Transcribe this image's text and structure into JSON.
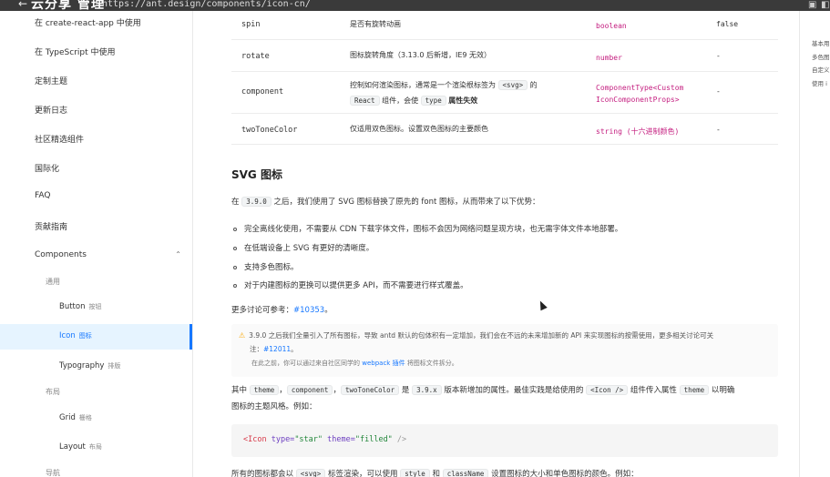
{
  "browser": {
    "back_glyph": "←",
    "brand": "云分享 管理",
    "url": "https://ant.design/components/icon-cn/",
    "ext_icon_1": "▣",
    "ext_icon_2": "◧"
  },
  "sidebar": {
    "items": [
      {
        "label": "在 create-react-app 中使用"
      },
      {
        "label": "在 TypeScript 中使用"
      },
      {
        "label": "定制主题"
      },
      {
        "label": "更新日志"
      },
      {
        "label": "社区精选组件"
      },
      {
        "label": "国际化"
      },
      {
        "label": "FAQ"
      },
      {
        "label": "贡献指南"
      },
      {
        "label": "Components",
        "caret": "⌃"
      },
      {
        "label": "通用"
      },
      {
        "label": "Button",
        "cn": "按钮"
      },
      {
        "label": "Icon",
        "cn": "图标"
      },
      {
        "label": "Typography",
        "cn": "排版"
      },
      {
        "label": "布局"
      },
      {
        "label": "Grid",
        "cn": "栅格"
      },
      {
        "label": "Layout",
        "cn": "布局"
      },
      {
        "label": "导航"
      }
    ]
  },
  "table": {
    "rows": [
      {
        "prop": "spin",
        "desc": "是否有旋转动画",
        "type": "boolean",
        "default": "false"
      },
      {
        "prop": "rotate",
        "desc": "图标旋转角度（3.13.0 后新增，IE9 无效）",
        "type": "number",
        "default": "-"
      },
      {
        "prop": "component",
        "desc_a": "控制如何渲染图标，通常是一个渲染根标签为",
        "desc_code1": "<svg>",
        "desc_b": "的",
        "desc_code2": "React",
        "desc_c": "组件，会使",
        "desc_code3": "type",
        "desc_d": "属性失效",
        "type_line1": "ComponentType<Custom",
        "type_line2": "IconComponentProps>",
        "default": "-"
      },
      {
        "prop": "twoToneColor",
        "desc": "仅适用双色图标。设置双色图标的主要颜色",
        "type": "string (十六进制颜色)",
        "default": "-"
      }
    ]
  },
  "section": {
    "title": "SVG 图标",
    "intro_a": "在",
    "intro_code": "3.9.0",
    "intro_b": "之后，我们使用了 SVG 图标替换了原先的 font 图标，从而带来了以下优势：",
    "bullets": [
      "完全离线化使用，不需要从 CDN 下载字体文件，图标不会因为网络问题呈现方块，也无需字体文件本地部署。",
      "在低端设备上 SVG 有更好的清晰度。",
      "支持多色图标。",
      "对于内建图标的更换可以提供更多 API，而不需要进行样式覆盖。"
    ],
    "more_a": "更多讨论可参考：",
    "more_link": "#10353",
    "more_b": "。",
    "warning": {
      "icon": "⚠",
      "line1": "3.9.0 之后我们全量引入了所有图标，导致 antd 默认的包体积有一定增加，我们会在不远的未来增加新的 API 来实现图标的按需使用，更多相关讨论可关",
      "line2_a": "注：",
      "line2_link": "#12011",
      "line2_b": "。",
      "line3_a": "在此之前，你可以通过来自社区同学的",
      "line3_link": "webpack 插件",
      "line3_b": "将图标文件拆分。"
    },
    "props_para": {
      "a": "其中",
      "c1": "theme",
      "sep1": "，",
      "c2": "component",
      "sep2": "，",
      "c3": "twoToneColor",
      "b": "是",
      "c4": "3.9.x",
      "c": "版本新增加的属性。最佳实践是给使用的",
      "c5": "<Icon />",
      "d": "组件传入属性",
      "c6": "theme",
      "e": "以明确",
      "line2": "图标的主题风格。例如："
    },
    "code": {
      "open": "<Icon",
      "attr1": " type=",
      "val1": "\"star\"",
      "attr2": " theme=",
      "val2": "\"filled\"",
      "close": " />"
    },
    "last_a": "所有的图标都会以",
    "last_c1": "<svg>",
    "last_b": "标签渲染，可以使用",
    "last_c2": "style",
    "last_c": "和",
    "last_c3": "className",
    "last_d": "设置图标的大小和单色图标的颜色。例如："
  },
  "right_rail": {
    "items": [
      "基本用",
      "多色图",
      "自定义",
      "使用 i"
    ]
  }
}
